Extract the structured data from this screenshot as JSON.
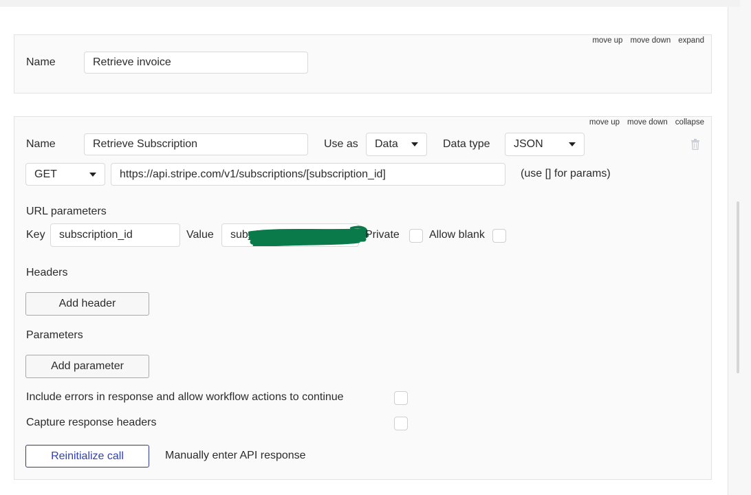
{
  "card_actions": {
    "move_up": "move up",
    "move_down": "move down",
    "expand": "expand",
    "collapse": "collapse"
  },
  "call1": {
    "name_label": "Name",
    "name_value": "Retrieve invoice"
  },
  "call2": {
    "name_label": "Name",
    "name_value": "Retrieve Subscription",
    "use_as_label": "Use as",
    "use_as_value": "Data",
    "data_type_label": "Data type",
    "data_type_value": "JSON",
    "method_value": "GET",
    "url_value": "https://api.stripe.com/v1/subscriptions/[subscription_id]",
    "url_hint": "(use [] for params)",
    "url_params_label": "URL parameters",
    "key_label": "Key",
    "key_value": "subscription_id",
    "value_label": "Value",
    "value_value": "sub_1RE...Zk4SWe1T",
    "private_label": "Private",
    "allow_blank_label": "Allow blank",
    "headers_label": "Headers",
    "add_header_label": "Add header",
    "parameters_label": "Parameters",
    "add_parameter_label": "Add parameter",
    "include_errors_label": "Include errors in response and allow workflow actions to continue",
    "capture_headers_label": "Capture response headers",
    "reinitialize_label": "Reinitialize call",
    "manual_response_label": "Manually enter API response"
  },
  "colors": {
    "accent": "#2f3fb5",
    "redaction": "#0b7a4b"
  }
}
